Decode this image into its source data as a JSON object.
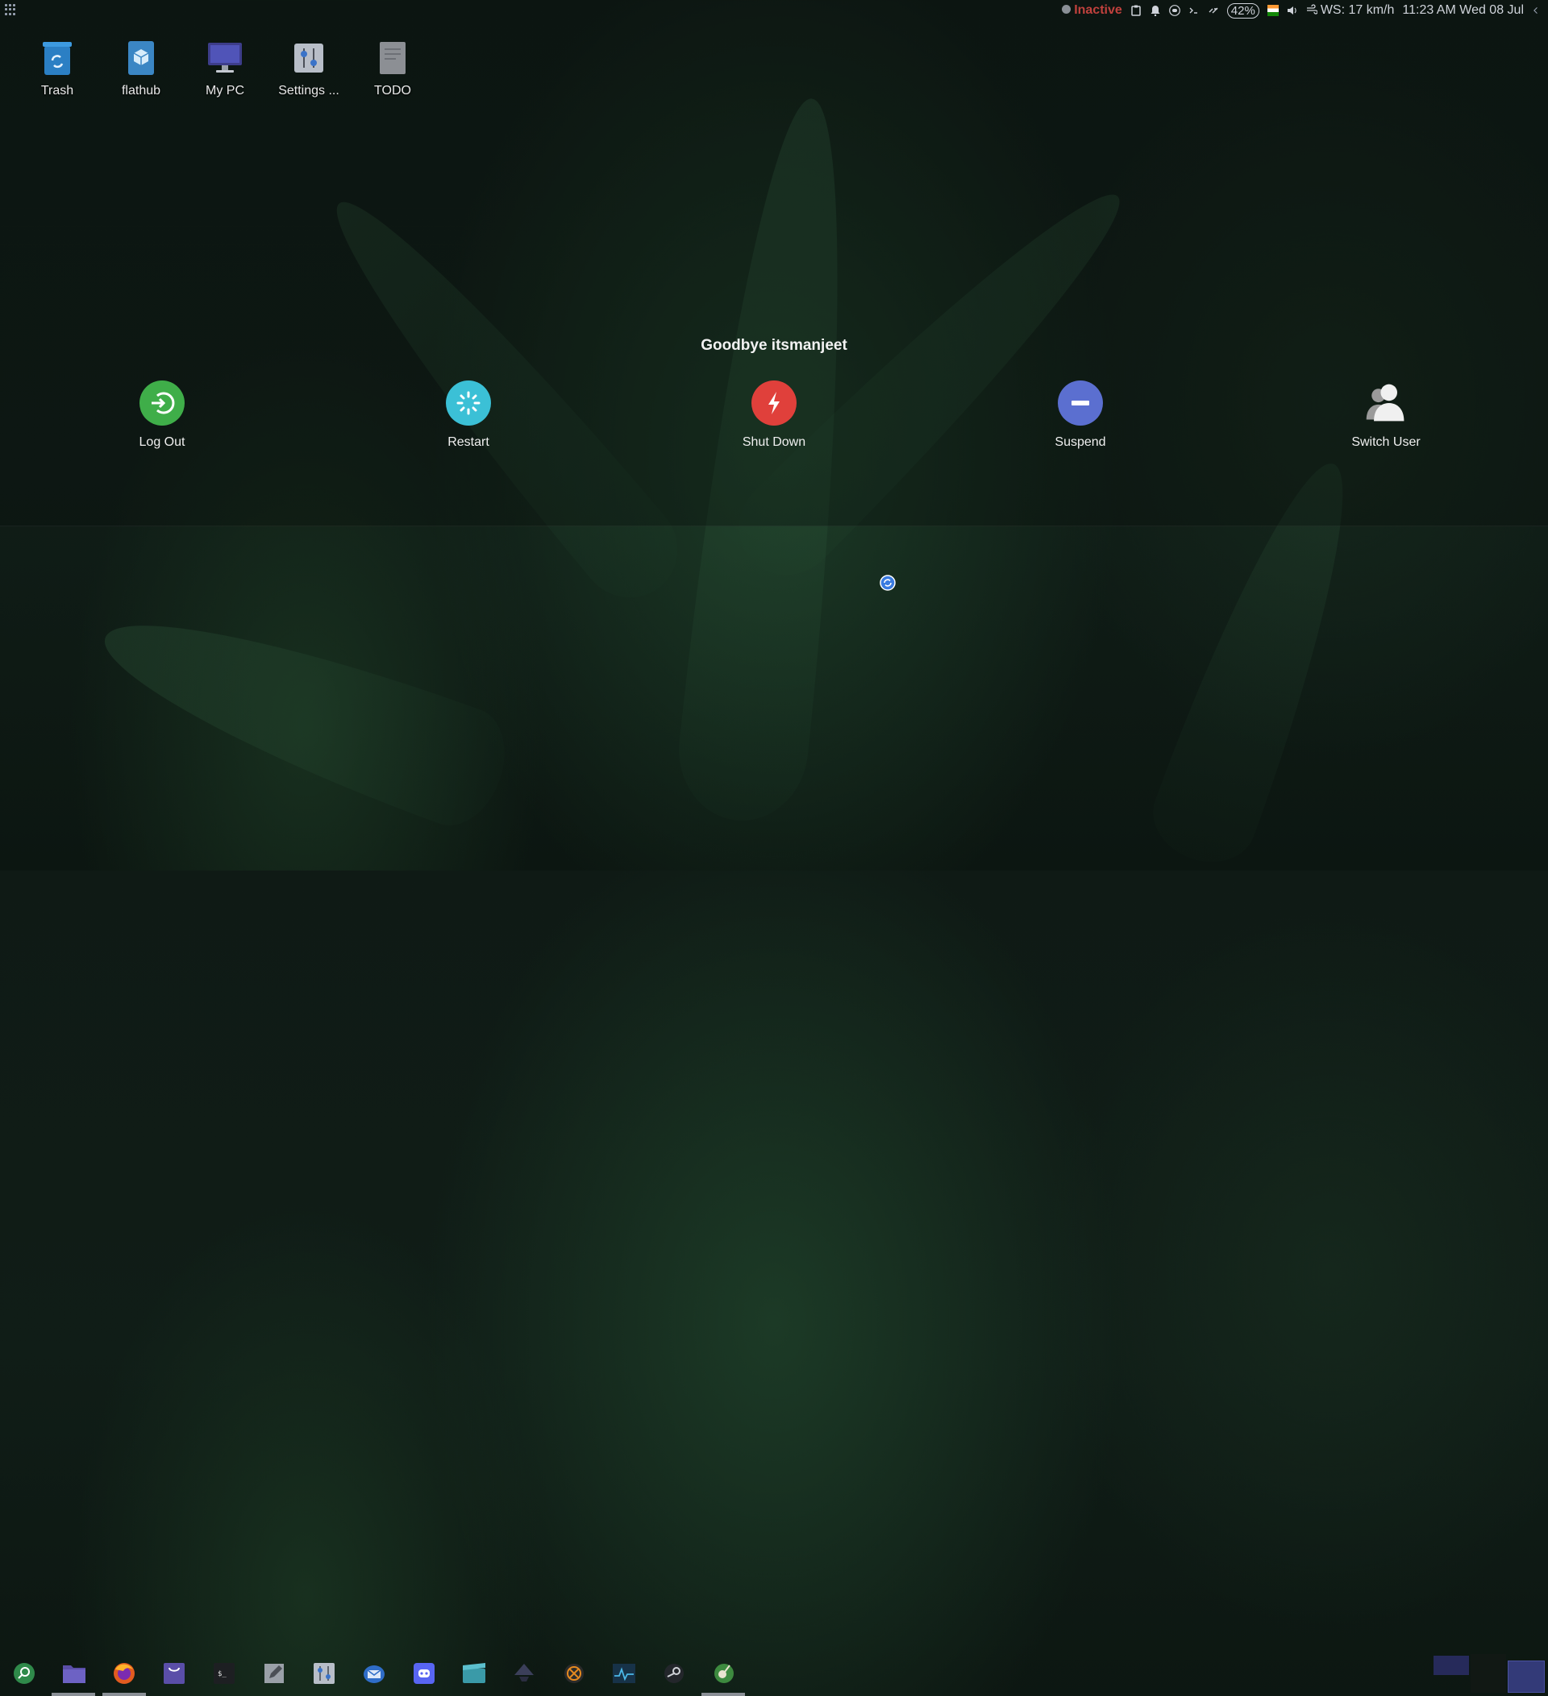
{
  "top_panel": {
    "status": "Inactive",
    "battery": "42%",
    "weather": "WS: 17 km/h",
    "clock": "11:23 AM Wed 08 Jul"
  },
  "desktop": {
    "icons": [
      {
        "label": "Trash",
        "icon": "trash-icon"
      },
      {
        "label": "flathub",
        "icon": "package-icon"
      },
      {
        "label": "My PC",
        "icon": "monitor-icon"
      },
      {
        "label": "Settings ...",
        "icon": "settings-icon"
      },
      {
        "label": "TODO",
        "icon": "document-icon"
      }
    ]
  },
  "logout_screen": {
    "greeting": "Goodbye itsmanjeet",
    "actions": [
      {
        "label": "Log Out",
        "icon": "logout-icon",
        "color": "#3fae49"
      },
      {
        "label": "Restart",
        "icon": "restart-icon",
        "color": "#3bc0d6"
      },
      {
        "label": "Shut Down",
        "icon": "power-icon",
        "color": "#e0403b"
      },
      {
        "label": "Suspend",
        "icon": "suspend-icon",
        "color": "#5b6fd0"
      },
      {
        "label": "Switch User",
        "icon": "switch-user-icon",
        "color": "#d9d9d9"
      }
    ]
  },
  "taskbar": {
    "apps": [
      "search-icon",
      "file-manager-icon",
      "firefox-icon",
      "store-icon",
      "terminal-icon",
      "text-editor-icon",
      "settings-icon",
      "thunderbird-icon",
      "discord-icon",
      "video-icon",
      "inkscape-icon",
      "blender-icon",
      "system-monitor-icon",
      "steam-icon",
      "gimp-icon"
    ]
  }
}
